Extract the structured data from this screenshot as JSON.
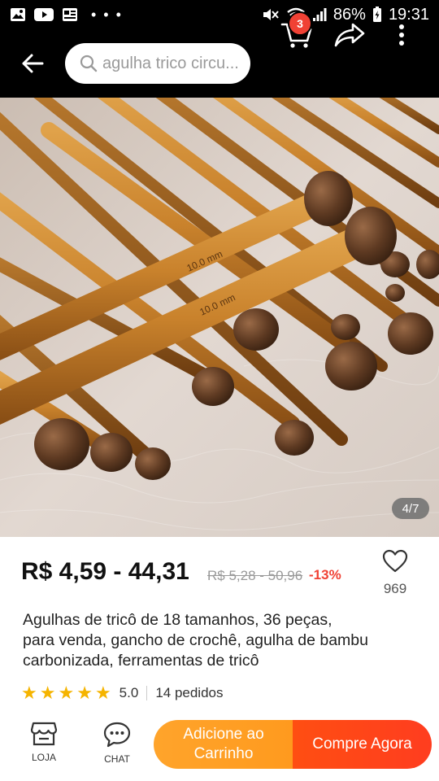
{
  "status_bar": {
    "battery": "86%",
    "time": "19:31",
    "left_icons": [
      "gallery-icon",
      "youtube-icon",
      "news-icon",
      "more-notifications-icon"
    ],
    "right_icons": [
      "mute-icon",
      "wifi-icon",
      "signal-icon",
      "battery-icon"
    ]
  },
  "header": {
    "search_placeholder": "agulha trico circu...",
    "cart_count": "3"
  },
  "product": {
    "image_counter": "4/7",
    "price": "R$ 4,59 - 44,31",
    "old_price": "R$ 5,28 - 50,96",
    "discount": "-13%",
    "favorites": "969",
    "title_lines": [
      "Agulhas de tricô de 18 tamanhos, 36 peças,",
      "para venda, gancho de crochê, agulha de bambu",
      "carbonizada, ferramentas de tricô"
    ],
    "rating": "5.0",
    "stars": 5,
    "orders": "14 pedidos",
    "needle_labels": [
      "10.0 mm",
      "10.0 mm"
    ]
  },
  "bottom_bar": {
    "store_label": "LOJA",
    "chat_label": "CHAT",
    "add_to_cart": "Adicione ao Carrinho",
    "buy_now": "Compre Agora"
  },
  "colors": {
    "accent_red": "#f04134",
    "cart_orange": "#ffa42b",
    "buy_red": "#ff4514",
    "star_yellow": "#f5b400"
  }
}
